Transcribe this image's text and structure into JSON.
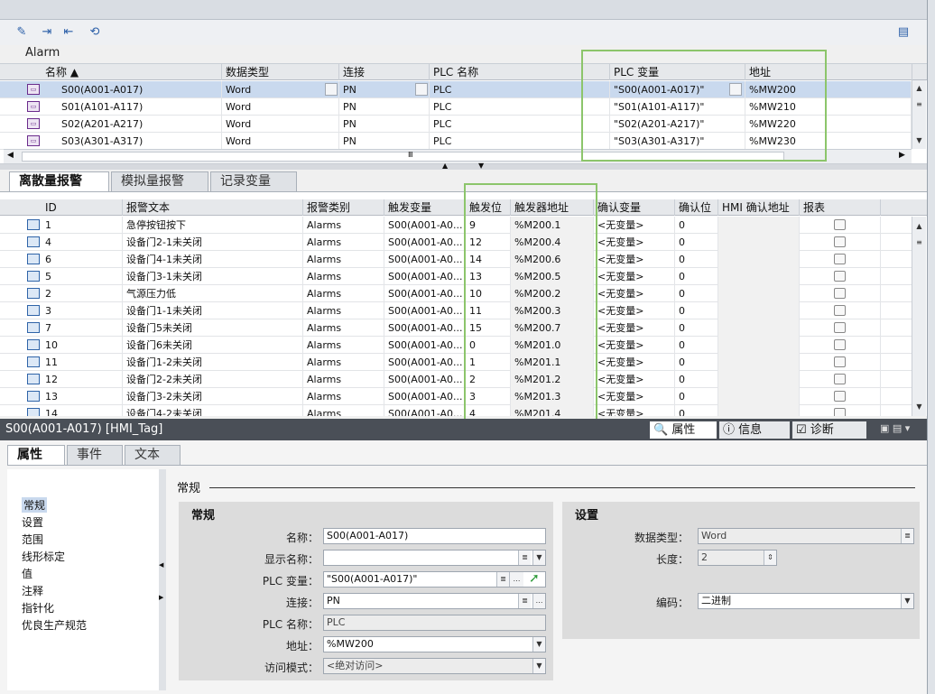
{
  "section_title": "Alarm",
  "tag_table": {
    "headers": [
      "名称",
      "数据类型",
      "连接",
      "PLC 名称",
      "PLC 变量",
      "地址"
    ],
    "rows": [
      [
        "S00(A001-A017)",
        "Word",
        "PN",
        "PLC",
        "\"S00(A001-A017)\"",
        "%MW200"
      ],
      [
        "S01(A101-A117)",
        "Word",
        "PN",
        "PLC",
        "\"S01(A101-A117)\"",
        "%MW210"
      ],
      [
        "S02(A201-A217)",
        "Word",
        "PN",
        "PLC",
        "\"S02(A201-A217)\"",
        "%MW220"
      ],
      [
        "S03(A301-A317)",
        "Word",
        "PN",
        "PLC",
        "\"S03(A301-A317)\"",
        "%MW230"
      ]
    ],
    "selected_row": 0
  },
  "alarm_tabs": [
    "离散量报警",
    "模拟量报警",
    "记录变量"
  ],
  "alarm_table": {
    "headers": [
      "ID",
      "报警文本",
      "报警类别",
      "触发变量",
      "触发位",
      "触发器地址",
      "确认变量",
      "确认位",
      "HMI 确认地址",
      "报表"
    ],
    "rows": [
      [
        "1",
        "急停按钮按下",
        "Alarms",
        "S00(A001-A0...",
        "9",
        "%M200.1",
        "<无变量>",
        "0",
        ""
      ],
      [
        "4",
        "设备门2-1未关闭",
        "Alarms",
        "S00(A001-A0...",
        "12",
        "%M200.4",
        "<无变量>",
        "0",
        ""
      ],
      [
        "6",
        "设备门4-1未关闭",
        "Alarms",
        "S00(A001-A0...",
        "14",
        "%M200.6",
        "<无变量>",
        "0",
        ""
      ],
      [
        "5",
        "设备门3-1未关闭",
        "Alarms",
        "S00(A001-A0...",
        "13",
        "%M200.5",
        "<无变量>",
        "0",
        ""
      ],
      [
        "2",
        "气源压力低",
        "Alarms",
        "S00(A001-A0...",
        "10",
        "%M200.2",
        "<无变量>",
        "0",
        ""
      ],
      [
        "3",
        "设备门1-1未关闭",
        "Alarms",
        "S00(A001-A0...",
        "11",
        "%M200.3",
        "<无变量>",
        "0",
        ""
      ],
      [
        "7",
        "设备门5未关闭",
        "Alarms",
        "S00(A001-A0...",
        "15",
        "%M200.7",
        "<无变量>",
        "0",
        ""
      ],
      [
        "10",
        "设备门6未关闭",
        "Alarms",
        "S00(A001-A0...",
        "0",
        "%M201.0",
        "<无变量>",
        "0",
        ""
      ],
      [
        "11",
        "设备门1-2未关闭",
        "Alarms",
        "S00(A001-A0...",
        "1",
        "%M201.1",
        "<无变量>",
        "0",
        ""
      ],
      [
        "12",
        "设备门2-2未关闭",
        "Alarms",
        "S00(A001-A0...",
        "2",
        "%M201.2",
        "<无变量>",
        "0",
        ""
      ],
      [
        "13",
        "设备门3-2未关闭",
        "Alarms",
        "S00(A001-A0...",
        "3",
        "%M201.3",
        "<无变量>",
        "0",
        ""
      ],
      [
        "14",
        "设备门4-2未关闭",
        "Alarms",
        "S00(A001-A0...",
        "4",
        "%M201.4",
        "<无变量>",
        "0",
        ""
      ]
    ]
  },
  "inspector": {
    "title": "S00(A001-A017) [HMI_Tag]",
    "right_tabs": [
      "属性",
      "信息",
      "诊断"
    ],
    "tabs": [
      "属性",
      "事件",
      "文本"
    ],
    "nav": [
      "常规",
      "设置",
      "范围",
      "线形标定",
      "值",
      "注释",
      "指针化",
      "优良生产规范"
    ],
    "section_header": "常规",
    "general": {
      "title": "常规",
      "name_label": "名称：",
      "name_value": "S00(A001-A017)",
      "display_label": "显示名称：",
      "display_value": "",
      "plc_var_label": "PLC 变量：",
      "plc_var_value": "\"S00(A001-A017)\"",
      "conn_label": "连接：",
      "conn_value": "PN",
      "plc_name_label": "PLC 名称：",
      "plc_name_value": "PLC",
      "addr_label": "地址：",
      "addr_value": "%MW200",
      "access_label": "访问模式：",
      "access_value": "<绝对访问>"
    },
    "settings": {
      "title": "设置",
      "dtype_label": "数据类型：",
      "dtype_value": "Word",
      "len_label": "长度：",
      "len_value": "2",
      "enc_label": "编码：",
      "enc_value": "二进制"
    }
  },
  "colors": {
    "highlight": "#8cc56b",
    "inspector_bar": "#4a4f57",
    "selection": "#c9d9ee"
  }
}
